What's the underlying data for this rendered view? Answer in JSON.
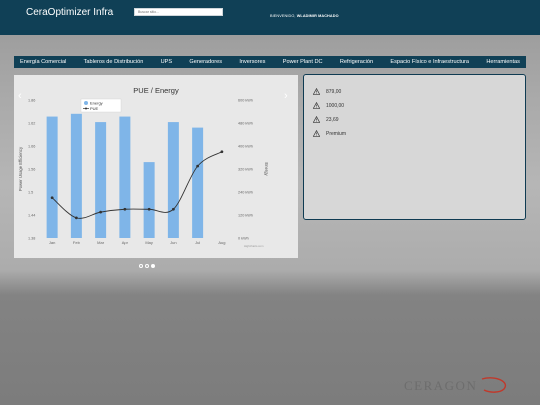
{
  "header": {
    "app_title": "CeraOptimizer Infra",
    "search_placeholder": "Buscar sitio...",
    "welcome_prefix": "BIENVENIDO,",
    "welcome_user": "WLADIMIR MACHADO"
  },
  "nav": {
    "items": [
      "Energía Comercial",
      "Tableros de Distribución",
      "UPS",
      "Generadores",
      "Inversores",
      "Power Plant DC",
      "Refrigeración",
      "Espacio Físico e Infraestructura",
      "Herramientas"
    ]
  },
  "colors": {
    "header": "#104056",
    "bar": "#7fb5e8",
    "line": "#333333",
    "alert_border": "#0f3b52"
  },
  "chart_data": {
    "type": "bar",
    "title": "PUE / Energy",
    "categories": [
      "Jan",
      "Feb",
      "Mar",
      "Apr",
      "May",
      "Jun",
      "Jul",
      "Aug"
    ],
    "series": [
      {
        "name": "Energy",
        "type": "bar",
        "axis": "right",
        "values": [
          440,
          450,
          420,
          440,
          275,
          420,
          400,
          0
        ]
      },
      {
        "name": "PUE",
        "type": "line",
        "axis": "left",
        "values": [
          1.52,
          1.45,
          1.47,
          1.48,
          1.48,
          1.48,
          1.63,
          1.68
        ]
      }
    ],
    "ylabel_left": "Power Usage Efficiency",
    "ylabel_right": "Energy",
    "ylim_left": [
      1.38,
      1.86
    ],
    "ylim_right": [
      0,
      500
    ],
    "yticks_left": [
      "1.86",
      "1.62",
      "1.66",
      "1.56",
      "1.5",
      "1.44",
      "1.38"
    ],
    "yticks_right": [
      "600 kWh",
      "480 kWh",
      "400 kWh",
      "320 kWh",
      "240 kWh",
      "120 kWh",
      "0 kWh"
    ],
    "legend": "top-left",
    "credit": "Highcharts.com",
    "grid": false
  },
  "carousel": {
    "active_index": 2,
    "count": 3
  },
  "alerts": [
    {
      "icon": "warning-icon",
      "value": "879,00"
    },
    {
      "icon": "warning-icon",
      "value": "1000,00"
    },
    {
      "icon": "warning-icon",
      "value": "23,69"
    },
    {
      "icon": "warning-icon",
      "value": "Premium"
    }
  ],
  "footer": {
    "logo_text": "CERAGON"
  }
}
